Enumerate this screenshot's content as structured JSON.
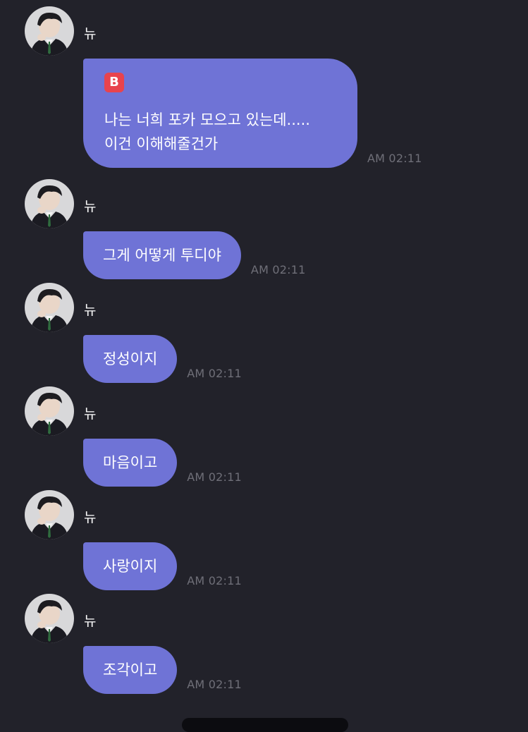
{
  "messages": [
    {
      "sender": "뉴",
      "has_badge": true,
      "badge_icon": "bubble-b-icon",
      "badge_letter": "B",
      "lines": [
        "나는 너희 포카 모으고 있는데.....",
        "이건 이해해줄건가"
      ],
      "time": "AM 02:11"
    },
    {
      "sender": "뉴",
      "lines": [
        "그게 어떻게 투디야"
      ],
      "time": "AM 02:11"
    },
    {
      "sender": "뉴",
      "lines": [
        "정성이지"
      ],
      "time": "AM 02:11"
    },
    {
      "sender": "뉴",
      "lines": [
        "마음이고"
      ],
      "time": "AM 02:11"
    },
    {
      "sender": "뉴",
      "lines": [
        "사랑이지"
      ],
      "time": "AM 02:11"
    },
    {
      "sender": "뉴",
      "lines": [
        "조각이고"
      ],
      "time": "AM 02:11"
    }
  ],
  "colors": {
    "background": "#22222a",
    "bubble": "#6f73d6",
    "timestamp": "#6f6f78",
    "badge": "#e8434d"
  }
}
